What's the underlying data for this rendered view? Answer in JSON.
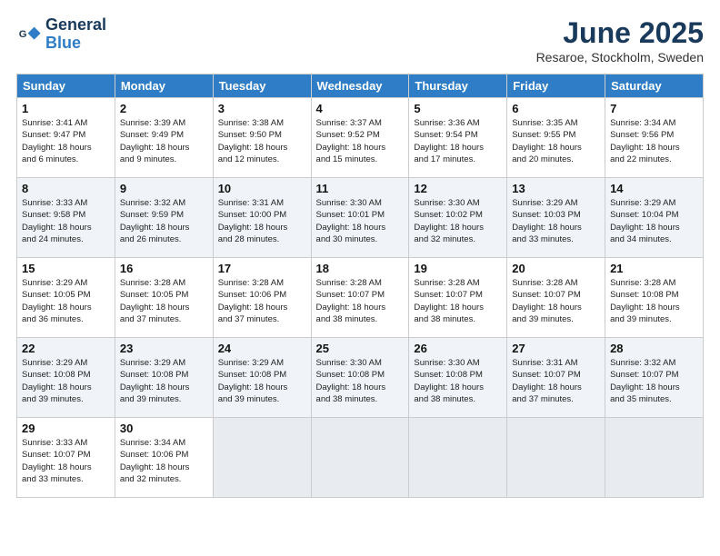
{
  "header": {
    "logo_line1": "General",
    "logo_line2": "Blue",
    "month_title": "June 2025",
    "location": "Resaroe, Stockholm, Sweden"
  },
  "days_of_week": [
    "Sunday",
    "Monday",
    "Tuesday",
    "Wednesday",
    "Thursday",
    "Friday",
    "Saturday"
  ],
  "weeks": [
    [
      {
        "day": "1",
        "sunrise": "3:41 AM",
        "sunset": "9:47 PM",
        "daylight": "18 hours and 6 minutes."
      },
      {
        "day": "2",
        "sunrise": "3:39 AM",
        "sunset": "9:49 PM",
        "daylight": "18 hours and 9 minutes."
      },
      {
        "day": "3",
        "sunrise": "3:38 AM",
        "sunset": "9:50 PM",
        "daylight": "18 hours and 12 minutes."
      },
      {
        "day": "4",
        "sunrise": "3:37 AM",
        "sunset": "9:52 PM",
        "daylight": "18 hours and 15 minutes."
      },
      {
        "day": "5",
        "sunrise": "3:36 AM",
        "sunset": "9:54 PM",
        "daylight": "18 hours and 17 minutes."
      },
      {
        "day": "6",
        "sunrise": "3:35 AM",
        "sunset": "9:55 PM",
        "daylight": "18 hours and 20 minutes."
      },
      {
        "day": "7",
        "sunrise": "3:34 AM",
        "sunset": "9:56 PM",
        "daylight": "18 hours and 22 minutes."
      }
    ],
    [
      {
        "day": "8",
        "sunrise": "3:33 AM",
        "sunset": "9:58 PM",
        "daylight": "18 hours and 24 minutes."
      },
      {
        "day": "9",
        "sunrise": "3:32 AM",
        "sunset": "9:59 PM",
        "daylight": "18 hours and 26 minutes."
      },
      {
        "day": "10",
        "sunrise": "3:31 AM",
        "sunset": "10:00 PM",
        "daylight": "18 hours and 28 minutes."
      },
      {
        "day": "11",
        "sunrise": "3:30 AM",
        "sunset": "10:01 PM",
        "daylight": "18 hours and 30 minutes."
      },
      {
        "day": "12",
        "sunrise": "3:30 AM",
        "sunset": "10:02 PM",
        "daylight": "18 hours and 32 minutes."
      },
      {
        "day": "13",
        "sunrise": "3:29 AM",
        "sunset": "10:03 PM",
        "daylight": "18 hours and 33 minutes."
      },
      {
        "day": "14",
        "sunrise": "3:29 AM",
        "sunset": "10:04 PM",
        "daylight": "18 hours and 34 minutes."
      }
    ],
    [
      {
        "day": "15",
        "sunrise": "3:29 AM",
        "sunset": "10:05 PM",
        "daylight": "18 hours and 36 minutes."
      },
      {
        "day": "16",
        "sunrise": "3:28 AM",
        "sunset": "10:05 PM",
        "daylight": "18 hours and 37 minutes."
      },
      {
        "day": "17",
        "sunrise": "3:28 AM",
        "sunset": "10:06 PM",
        "daylight": "18 hours and 37 minutes."
      },
      {
        "day": "18",
        "sunrise": "3:28 AM",
        "sunset": "10:07 PM",
        "daylight": "18 hours and 38 minutes."
      },
      {
        "day": "19",
        "sunrise": "3:28 AM",
        "sunset": "10:07 PM",
        "daylight": "18 hours and 38 minutes."
      },
      {
        "day": "20",
        "sunrise": "3:28 AM",
        "sunset": "10:07 PM",
        "daylight": "18 hours and 39 minutes."
      },
      {
        "day": "21",
        "sunrise": "3:28 AM",
        "sunset": "10:08 PM",
        "daylight": "18 hours and 39 minutes."
      }
    ],
    [
      {
        "day": "22",
        "sunrise": "3:29 AM",
        "sunset": "10:08 PM",
        "daylight": "18 hours and 39 minutes."
      },
      {
        "day": "23",
        "sunrise": "3:29 AM",
        "sunset": "10:08 PM",
        "daylight": "18 hours and 39 minutes."
      },
      {
        "day": "24",
        "sunrise": "3:29 AM",
        "sunset": "10:08 PM",
        "daylight": "18 hours and 39 minutes."
      },
      {
        "day": "25",
        "sunrise": "3:30 AM",
        "sunset": "10:08 PM",
        "daylight": "18 hours and 38 minutes."
      },
      {
        "day": "26",
        "sunrise": "3:30 AM",
        "sunset": "10:08 PM",
        "daylight": "18 hours and 38 minutes."
      },
      {
        "day": "27",
        "sunrise": "3:31 AM",
        "sunset": "10:07 PM",
        "daylight": "18 hours and 37 minutes."
      },
      {
        "day": "28",
        "sunrise": "3:32 AM",
        "sunset": "10:07 PM",
        "daylight": "18 hours and 35 minutes."
      }
    ],
    [
      {
        "day": "29",
        "sunrise": "3:33 AM",
        "sunset": "10:07 PM",
        "daylight": "18 hours and 33 minutes."
      },
      {
        "day": "30",
        "sunrise": "3:34 AM",
        "sunset": "10:06 PM",
        "daylight": "18 hours and 32 minutes."
      },
      null,
      null,
      null,
      null,
      null
    ]
  ]
}
